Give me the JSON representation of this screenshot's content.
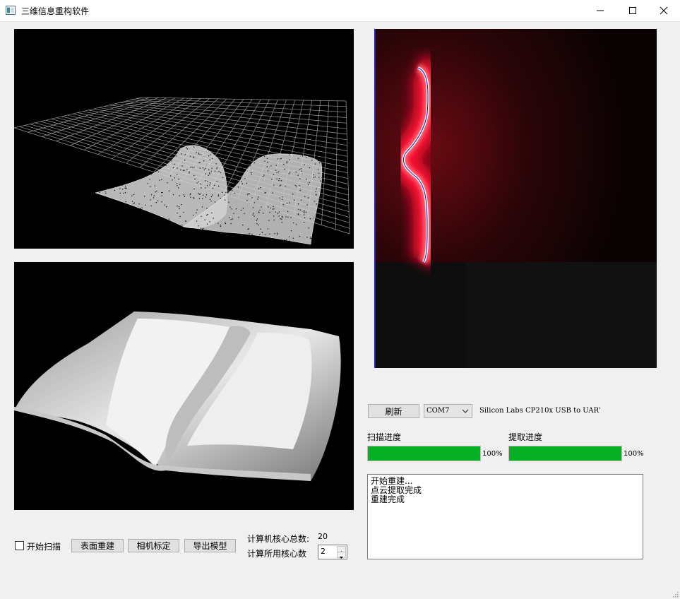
{
  "window": {
    "title": "三维信息重构软件",
    "icons": [
      "app-window-icon",
      "minimize-icon",
      "maximize-icon",
      "close-icon"
    ]
  },
  "views": {
    "point_cloud": "point-cloud-wireframe-view",
    "mesh": "surface-mesh-view",
    "camera": "laser-camera-view"
  },
  "controls": {
    "start_scan_label": "开始扫描",
    "surface_rebuild_label": "表面重建",
    "camera_calibrate_label": "相机标定",
    "export_model_label": "导出模型",
    "total_cores_label": "计算机核心总数:",
    "total_cores_value": "20",
    "used_cores_label": "计算所用核心数",
    "used_cores_value": "2"
  },
  "serial": {
    "refresh_label": "刷新",
    "port_value": "COM7",
    "device_name": "Silicon Labs CP210x USB to UAR'"
  },
  "progress": {
    "scan_label": "扫描进度",
    "scan_value": 100,
    "scan_text": "100%",
    "extract_label": "提取进度",
    "extract_value": 100,
    "extract_text": "100%",
    "color": "#06b025"
  },
  "log": {
    "lines": [
      "开始重建...",
      "点云提取完成",
      "重建完成"
    ]
  }
}
